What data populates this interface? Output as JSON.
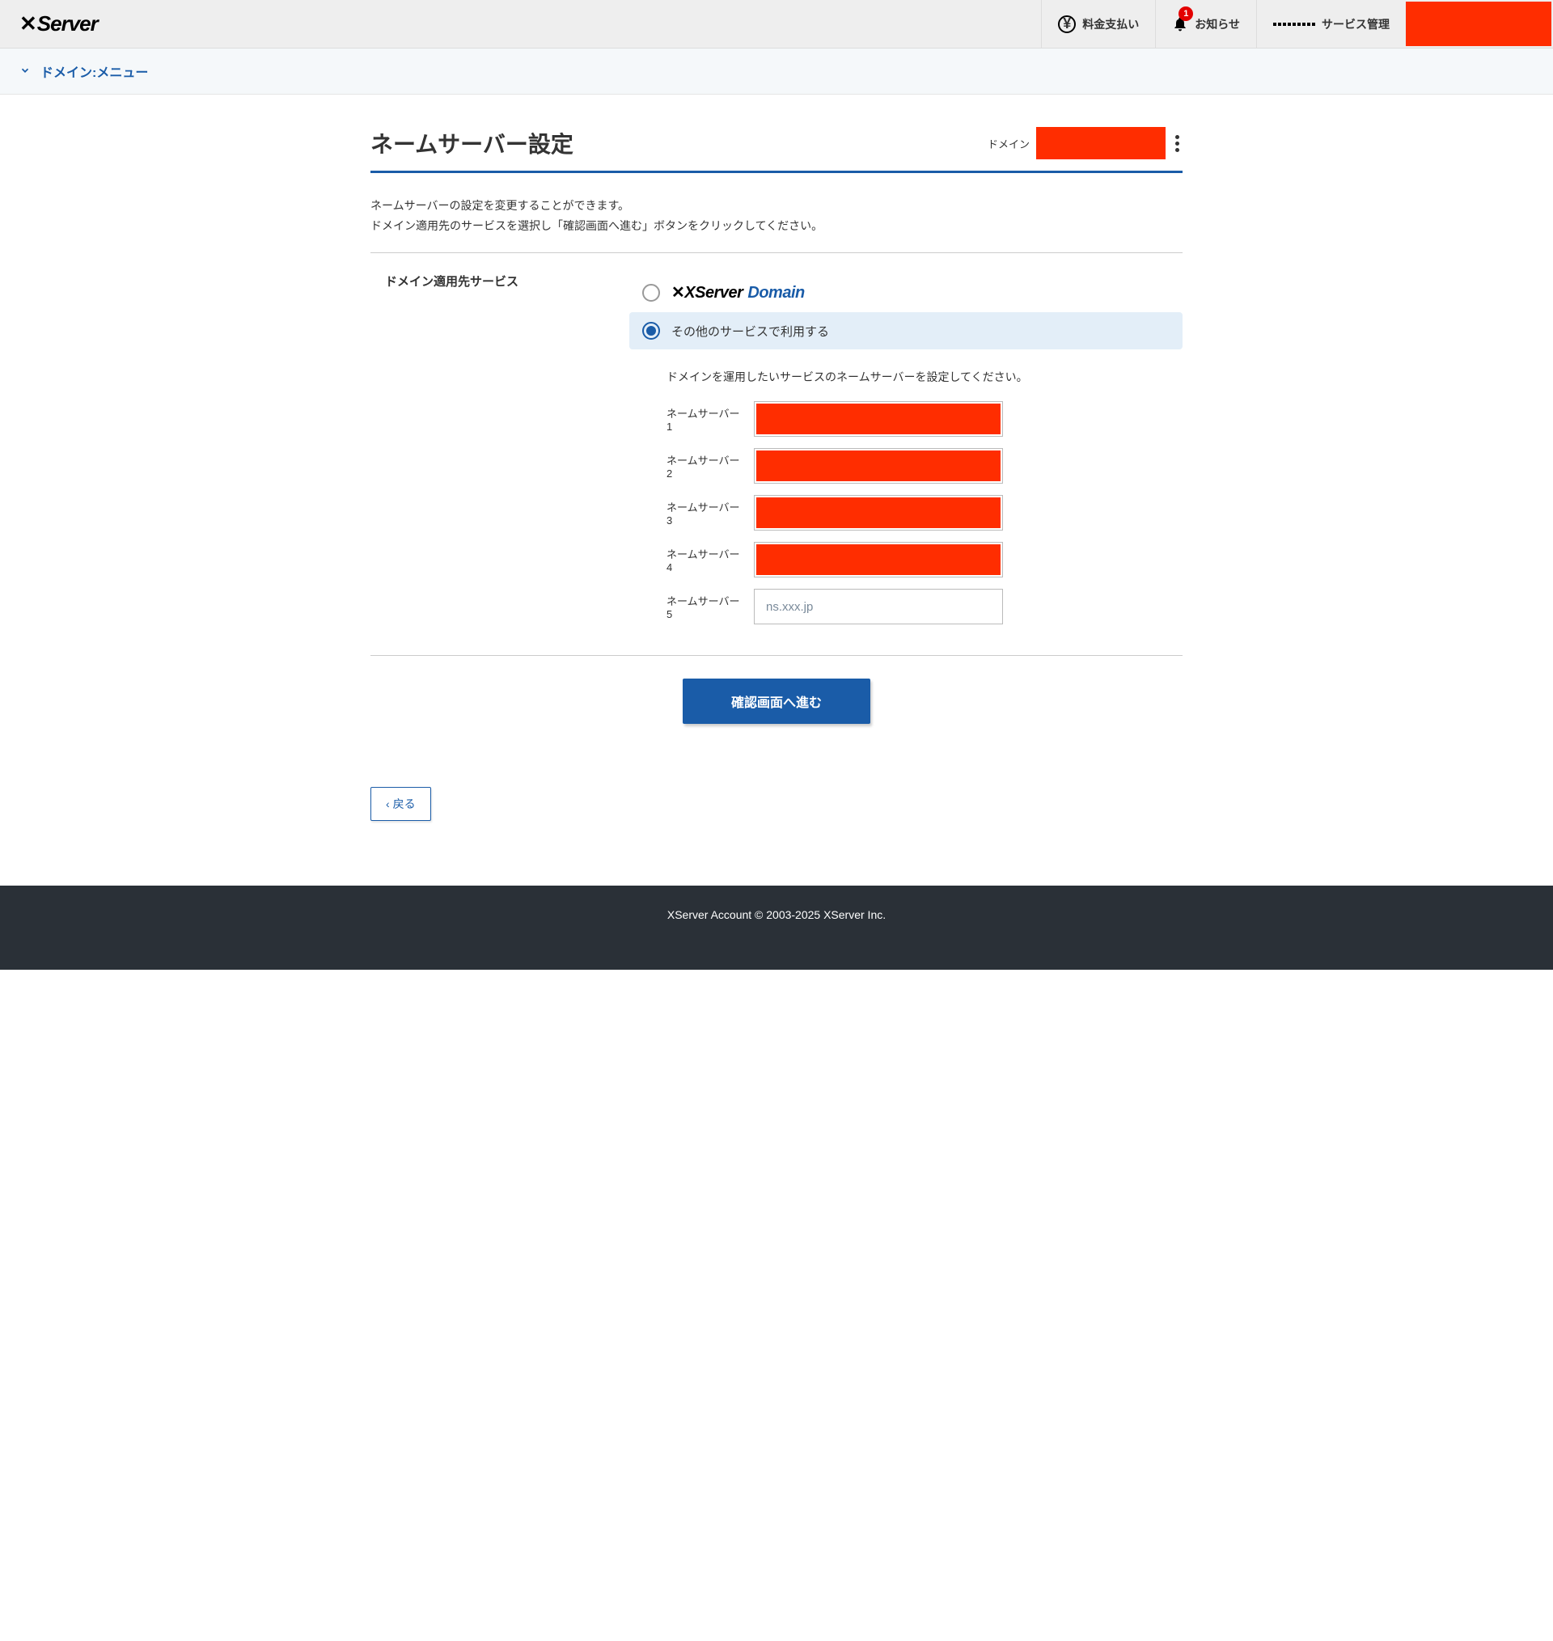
{
  "header": {
    "logo": "XServer",
    "nav": {
      "payment": "料金支払い",
      "notice": "お知らせ",
      "notice_badge": "1",
      "service": "サービス管理"
    }
  },
  "subnav": {
    "label": "ドメイン:メニュー"
  },
  "page": {
    "title": "ネームサーバー設定",
    "domain_label": "ドメイン",
    "desc_line1": "ネームサーバーの設定を変更することができます。",
    "desc_line2": "ドメイン適用先のサービスを選択し「確認画面へ進む」ボタンをクリックしてください。"
  },
  "section": {
    "label": "ドメイン適用先サービス",
    "option_xserver_domain_prefix": "XServer",
    "option_xserver_domain_suffix": "Domain",
    "option_other": "その他のサービスで利用する",
    "ns_hint": "ドメインを運用したいサービスのネームサーバーを設定してください。",
    "ns_labels": {
      "ns1": "ネームサーバー1",
      "ns2": "ネームサーバー2",
      "ns3": "ネームサーバー3",
      "ns4": "ネームサーバー4",
      "ns5": "ネームサーバー5"
    },
    "ns5_placeholder": "ns.xxx.jp"
  },
  "actions": {
    "confirm": "確認画面へ進む",
    "back": "戻る"
  },
  "footer": {
    "copyright": "XServer Account © 2003-2025 XServer Inc."
  }
}
